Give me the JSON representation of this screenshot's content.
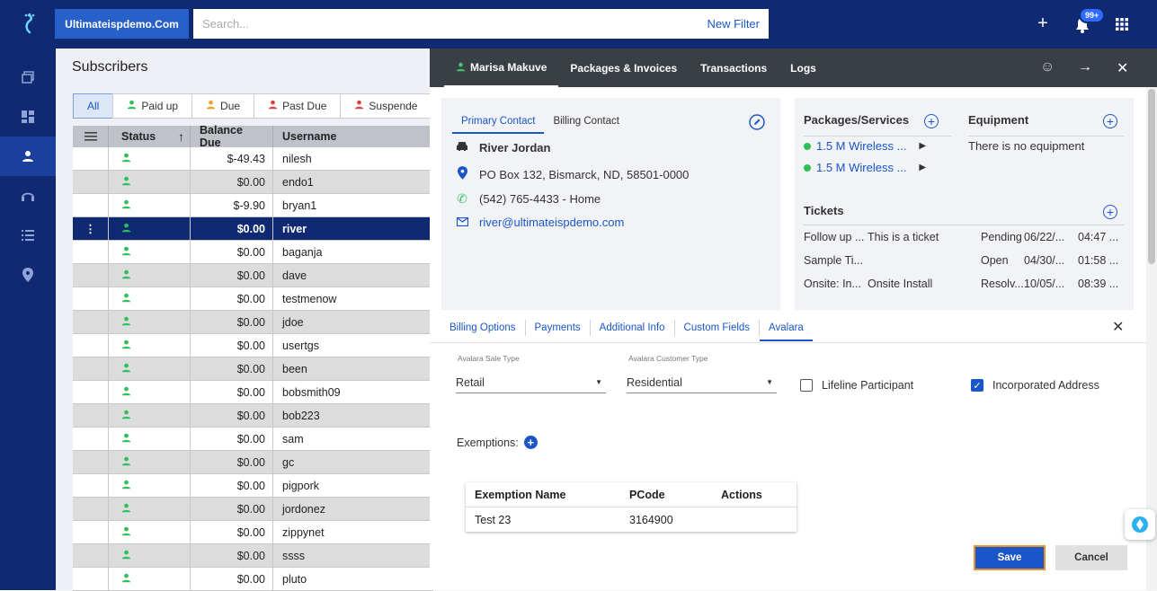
{
  "topbar": {
    "brand": "Ultimateispdemo.Com",
    "search_placeholder": "Search...",
    "new_filter": "New Filter",
    "notification_badge": "99+"
  },
  "left": {
    "title": "Subscribers",
    "filters": [
      {
        "label": "All",
        "color": "#1a56c8"
      },
      {
        "label": "Paid up",
        "color": "#2fbf5a"
      },
      {
        "label": "Due",
        "color": "#f0a020"
      },
      {
        "label": "Past Due",
        "color": "#e04040"
      },
      {
        "label": "Suspende",
        "color": "#e04040"
      }
    ],
    "columns": {
      "status": "Status",
      "balance": "Balance Due",
      "username": "Username"
    },
    "rows": [
      {
        "balance": "$-49.43",
        "username": "nilesh"
      },
      {
        "balance": "$0.00",
        "username": "endo1"
      },
      {
        "balance": "$-9.90",
        "username": "bryan1"
      },
      {
        "balance": "$0.00",
        "username": "river"
      },
      {
        "balance": "$0.00",
        "username": "baganja"
      },
      {
        "balance": "$0.00",
        "username": "dave"
      },
      {
        "balance": "$0.00",
        "username": "testmenow"
      },
      {
        "balance": "$0.00",
        "username": "jdoe"
      },
      {
        "balance": "$0.00",
        "username": "usertgs"
      },
      {
        "balance": "$0.00",
        "username": "been"
      },
      {
        "balance": "$0.00",
        "username": "bobsmith09"
      },
      {
        "balance": "$0.00",
        "username": "bob223"
      },
      {
        "balance": "$0.00",
        "username": "sam"
      },
      {
        "balance": "$0.00",
        "username": "gc"
      },
      {
        "balance": "$0.00",
        "username": "pigpork"
      },
      {
        "balance": "$0.00",
        "username": "jordonez"
      },
      {
        "balance": "$0.00",
        "username": "zippynet"
      },
      {
        "balance": "$0.00",
        "username": "ssss"
      },
      {
        "balance": "$0.00",
        "username": "pluto"
      }
    ]
  },
  "panel": {
    "tabs": {
      "subscriber": "Marisa Makuve",
      "packages": "Packages & Invoices",
      "transactions": "Transactions",
      "logs": "Logs"
    },
    "contact": {
      "tab_primary": "Primary Contact",
      "tab_billing": "Billing Contact",
      "name": "River Jordan",
      "address": "PO Box 132, Bismarck, ND, 58501-0000",
      "phone": "(542) 765-4433 - Home",
      "email": "river@ultimateispdemo.com"
    },
    "packages": {
      "header": "Packages/Services",
      "items": [
        "1.5 M Wireless ...",
        "1.5 M Wireless ..."
      ],
      "equipment_header": "Equipment",
      "equipment_empty": "There is no equipment",
      "tickets_header": "Tickets",
      "tickets": [
        {
          "subject": "Follow up ...",
          "desc": "This is a ticket",
          "status": "Pending",
          "date": "06/22/...",
          "time": "04:47 ..."
        },
        {
          "subject": "Sample Ti...",
          "desc": "",
          "status": "Open",
          "date": "04/30/...",
          "time": "01:58 ..."
        },
        {
          "subject": "Onsite: In...",
          "desc": "Onsite Install",
          "status": "Resolv...",
          "date": "10/05/...",
          "time": "08:39 ..."
        }
      ]
    },
    "bottom_tabs": [
      "Billing Options",
      "Payments",
      "Additional Info",
      "Custom Fields",
      "Avalara"
    ],
    "avalara": {
      "sale_type_label": "Avalara Sale Type",
      "sale_type_value": "Retail",
      "customer_type_label": "Avalara Customer Type",
      "customer_type_value": "Residential",
      "lifeline_label": "Lifeline Participant",
      "incorporated_label": "Incorporated Address",
      "exemptions_label": "Exemptions:",
      "exemption_cols": {
        "name": "Exemption Name",
        "pcode": "PCode",
        "actions": "Actions"
      },
      "exemptions": [
        {
          "name": "Test 23",
          "pcode": "3164900",
          "actions": ""
        }
      ]
    },
    "save_label": "Save",
    "cancel_label": "Cancel"
  }
}
